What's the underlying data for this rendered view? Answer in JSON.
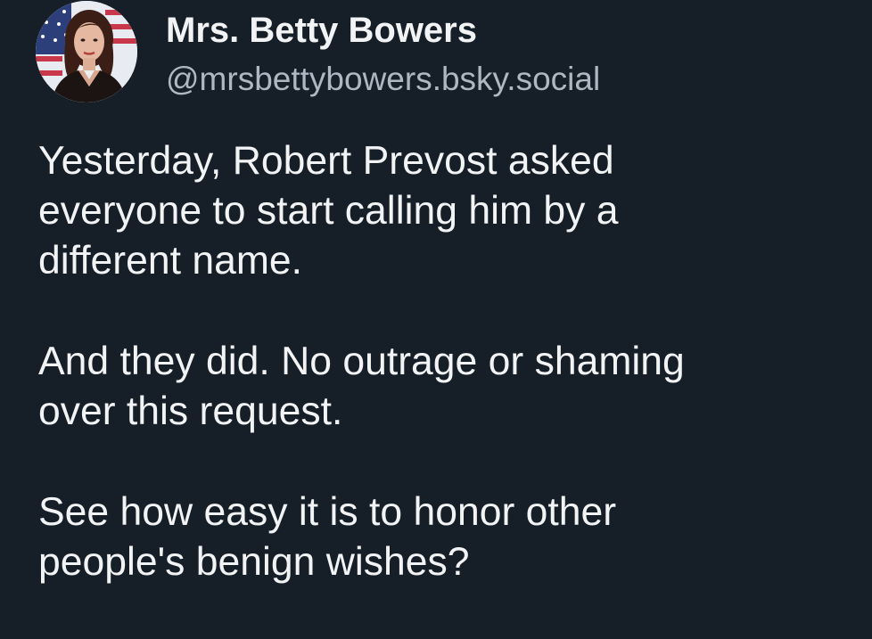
{
  "author": {
    "display_name": "Mrs. Betty Bowers",
    "handle": "@mrsbettybowers.bsky.social",
    "avatar_icon": "profile-photo"
  },
  "post": {
    "paragraphs": [
      {
        "lines": [
          "Yesterday, Robert Prevost asked",
          "everyone to start calling him by a",
          "different name."
        ]
      },
      {
        "lines": [
          "And they did. No outrage or shaming",
          "over this request."
        ]
      },
      {
        "lines": [
          "See how easy it is to honor other",
          "people's benign wishes?"
        ]
      }
    ]
  },
  "colors": {
    "background": "#161e27",
    "text": "#f1f3f5",
    "handle": "#aeb8c3"
  }
}
